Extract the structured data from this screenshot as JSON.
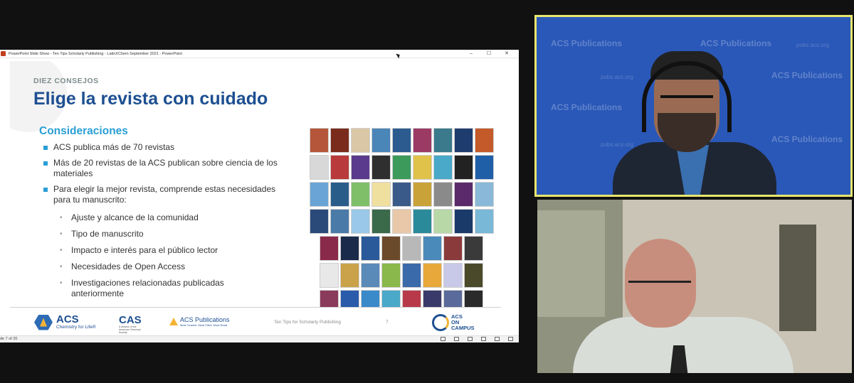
{
  "window": {
    "title": "PowerPoint Slide Show  -  Ten Tips Scholarly Publishing - LatinXChem September 2021 - PowerPoint",
    "controls": [
      "–",
      "☐",
      "✕"
    ]
  },
  "slide": {
    "eyebrow": "DIEZ CONSEJOS",
    "heading": "Elige la revista con cuidado",
    "subheading": "Consideraciones",
    "bullets": [
      "ACS publica más de 70 revistas",
      "Más de 20 revistas de la ACS publican sobre ciencia de los materiales",
      "Para elegir la mejor revista, comprende estas necesidades para tu manuscrito:"
    ],
    "subbullets": [
      "Ajuste y alcance de la comunidad",
      "Tipo de manuscrito",
      "Impacto e interés para el público lector",
      "Necesidades de Open Access",
      "Investigaciones relacionadas publicadas anteriormente"
    ],
    "cover_colors": [
      [
        "#b5563a",
        "#7a2b1c",
        "#d9c7a6",
        "#4a86b8",
        "#2c5b8f",
        "#9c3a66",
        "#3a7a8c",
        "#1f3c6e",
        "#c45a2a"
      ],
      [
        "#d8d8d8",
        "#b83a3a",
        "#5a3a8c",
        "#2f2f2f",
        "#3c9a5a",
        "#e0c24a",
        "#4aa8c8",
        "#222222",
        "#1f5fa8"
      ],
      [
        "#6aa4d6",
        "#2a5c8a",
        "#7fbf6a",
        "#f0e0a0",
        "#3a5a8a",
        "#caa23a",
        "#8a8a8a",
        "#5a2a6a",
        "#8ab8d8"
      ],
      [
        "#2a4a7a",
        "#4a7aa8",
        "#9ac8e8",
        "#3a6a4a",
        "#e8c8a8",
        "#2a8a9a",
        "#b8d8a8",
        "#1a3a6a",
        "#7ab8d8"
      ],
      [
        "#8a2a4a",
        "#1a2a4a",
        "#2a5a9a",
        "#6a4a2a",
        "#b8b8b8",
        "#4a8aba",
        "#8a3a3a",
        "#3a3a3a"
      ],
      [
        "#e8e8e8",
        "#caa24a",
        "#5a8ab8",
        "#8ab84a",
        "#3a6aaa",
        "#e8a83a",
        "#c8c8e8",
        "#4a4a2a"
      ],
      [
        "#8a3a5a",
        "#2a5aaa",
        "#3a8aca",
        "#4aa8c8",
        "#b83a4a",
        "#3a3a6a",
        "#5a6a9a",
        "#2a2a2a"
      ],
      [
        "#d8cfb8",
        "#e8e8e8",
        "#5a2a9a",
        "#8a5a3a",
        "#2a6ab8",
        "#d8e8c8"
      ]
    ]
  },
  "footer": {
    "acs_main": "ACS",
    "acs_tagline": "Chemistry for Life®",
    "cas_main": "CAS",
    "cas_tagline": "A division of the American Chemical Society",
    "pub_main": "ACS Publications",
    "pub_tagline": "Most Trusted. Most Cited. Most Read.",
    "center_text": "Ten Tips for Scholarly Publishing",
    "page_number": "7",
    "campus_line1": "ACS",
    "campus_line2": "ON",
    "campus_line3": "CAMPUS"
  },
  "statusbar": {
    "slide_count": "de 7 of 20"
  },
  "video_top": {
    "watermark": "ACS Publications",
    "watermark_small": "pubs.acs.org"
  },
  "colors": {
    "heading_blue": "#1d4f91",
    "accent_cyan": "#2a9fd6",
    "active_speaker_border": "#e7e56f",
    "backdrop_blue": "#2a58b8"
  }
}
